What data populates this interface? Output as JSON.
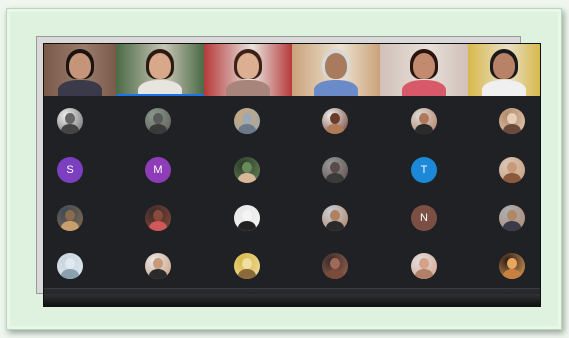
{
  "video_tiles": [
    {
      "bg": "#7a5a4a",
      "wall": "#9b7b6b",
      "hair": "#1a1410",
      "skin": "#c69478",
      "shirt": "#3b3a4a",
      "label": ""
    },
    {
      "bg": "#4a6a46",
      "wall": "#c8c4b4",
      "hair": "#2a1a12",
      "skin": "#d8a88a",
      "shirt": "#e8e4e0",
      "label": "",
      "speaking": true
    },
    {
      "bg": "#b53a3a",
      "wall": "#e9e4de",
      "hair": "#3a2216",
      "skin": "#dcae92",
      "shirt": "#a8857a",
      "label": ""
    },
    {
      "bg": "#caa27a",
      "wall": "#ece2d0",
      "hair": "#d8d8d8",
      "skin": "#a87a5e",
      "shirt": "#6a8ac8",
      "label": ""
    },
    {
      "bg": "#d0c0b8",
      "wall": "#e8e0da",
      "hair": "#2a1410",
      "skin": "#c28a6e",
      "shirt": "#d85a6a",
      "label": ""
    },
    {
      "bg": "#d8b84a",
      "wall": "#e8e0c8",
      "hair": "#1a1a1a",
      "skin": "#b88268",
      "shirt": "#f0f0f0",
      "label": ""
    }
  ],
  "participants": [
    {
      "type": "photo",
      "c1": "#eeeeee",
      "c2": "#444444",
      "c3": "#666666"
    },
    {
      "type": "photo",
      "c1": "#8a9a8a",
      "c2": "#3a3a3a",
      "c3": "#5a5a5a"
    },
    {
      "type": "photo",
      "c1": "#c8a878",
      "c2": "#6a7a8a",
      "c3": "#9aa8b8"
    },
    {
      "type": "photo",
      "c1": "#f0f0f0",
      "c2": "#b07a58",
      "c3": "#6a3a2a"
    },
    {
      "type": "photo",
      "c1": "#dcdcdc",
      "c2": "#2a2a2a",
      "c3": "#b07a5a"
    },
    {
      "type": "photo",
      "c1": "#b08868",
      "c2": "#6a4a38",
      "c3": "#e8d0b8"
    },
    {
      "type": "letter",
      "letter": "S",
      "color": "#7b3fbf"
    },
    {
      "type": "letter",
      "letter": "M",
      "color": "#8e3cb8"
    },
    {
      "type": "photo",
      "c1": "#2a3a2a",
      "c2": "#d8b898",
      "c3": "#6a8a5a"
    },
    {
      "type": "photo",
      "c1": "#9a9a9a",
      "c2": "#3a3a3a",
      "c3": "#5a4a4a"
    },
    {
      "type": "letter",
      "letter": "T",
      "color": "#1b88d8"
    },
    {
      "type": "photo",
      "c1": "#d8c8b8",
      "c2": "#8a5a3a",
      "c3": "#c89a7a"
    },
    {
      "type": "photo",
      "c1": "#3a4a5a",
      "c2": "#c8a070",
      "c3": "#8a6a4a"
    },
    {
      "type": "photo",
      "c1": "#3a2a2a",
      "c2": "#d05858",
      "c3": "#8a4a3a"
    },
    {
      "type": "photo",
      "c1": "#e8e8e8",
      "c2": "#222222",
      "c3": "#f4f4f4"
    },
    {
      "type": "photo",
      "c1": "#c8d0d8",
      "c2": "#2a2a2a",
      "c3": "#b08060"
    },
    {
      "type": "letter",
      "letter": "N",
      "color": "#7b4f44"
    },
    {
      "type": "photo",
      "c1": "#aab0b8",
      "c2": "#3a3a4a",
      "c3": "#b08868"
    },
    {
      "type": "photo",
      "c1": "#c8d4dc",
      "c2": "#8aa0b0",
      "c3": "#e0e8f0"
    },
    {
      "type": "photo",
      "c1": "#e8e8e8",
      "c2": "#2a2a2a",
      "c3": "#c89a7a"
    },
    {
      "type": "photo",
      "c1": "#d8b84a",
      "c2": "#8a6a3a",
      "c3": "#f0e0a0"
    },
    {
      "type": "photo",
      "c1": "#3a2a28",
      "c2": "#7a4a3a",
      "c3": "#a06a58"
    },
    {
      "type": "photo",
      "c1": "#e0e0e0",
      "c2": "#b08068",
      "c3": "#d8a088"
    },
    {
      "type": "photo",
      "c1": "#2a1a14",
      "c2": "#c88040",
      "c3": "#e8a860"
    }
  ]
}
